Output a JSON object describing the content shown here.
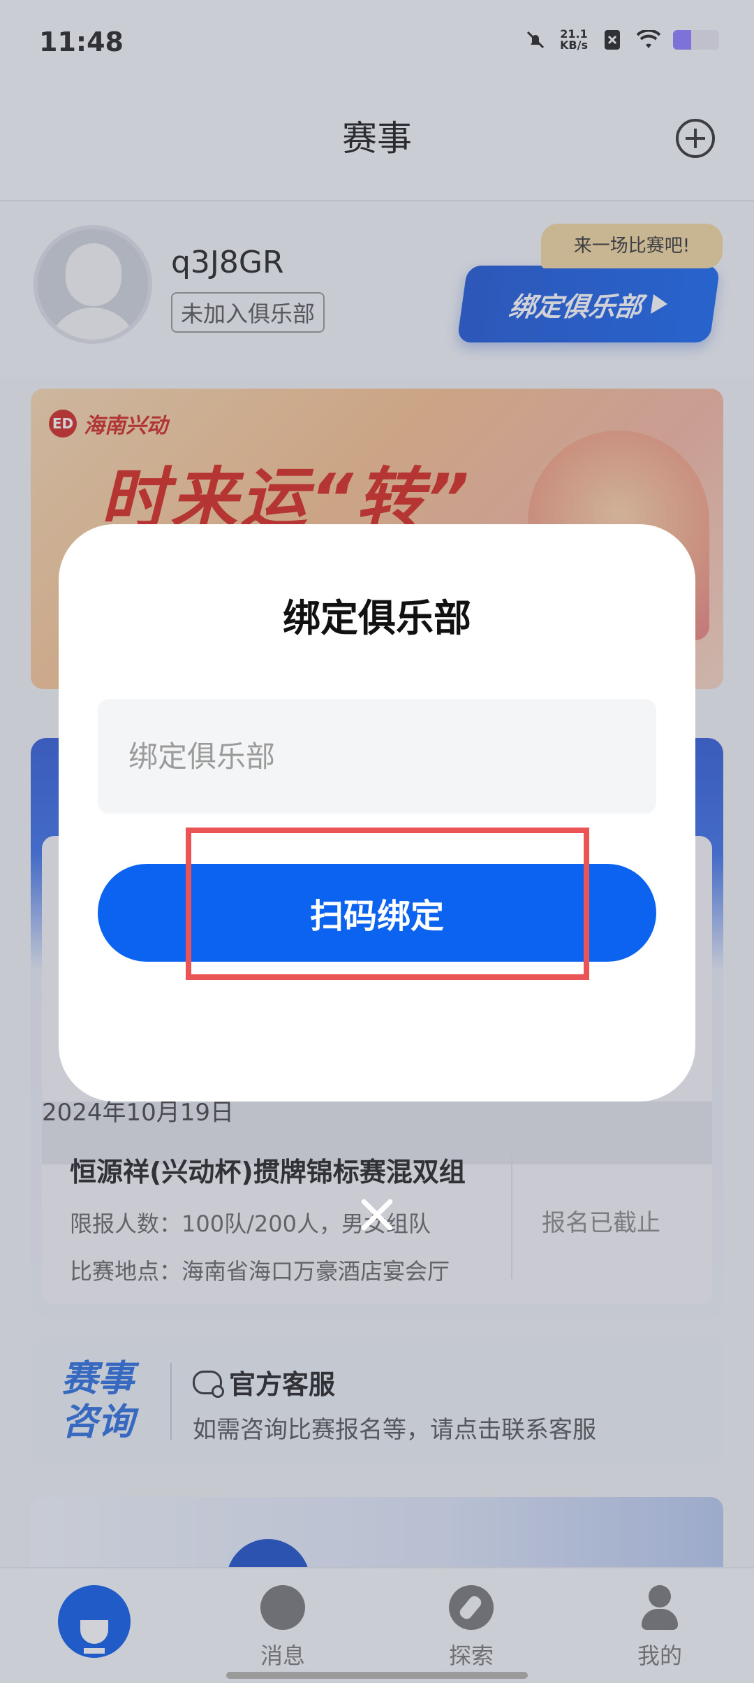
{
  "status_bar": {
    "time": "11:48",
    "net_speed_value": "21.1",
    "net_speed_unit": "KB/s",
    "battery_level": 0.4
  },
  "header": {
    "title": "赛事"
  },
  "profile": {
    "username": "q3J8GR",
    "club_status": "未加入俱乐部",
    "bubble_text": "来一场比赛吧!",
    "bind_button_label": "绑定俱乐部"
  },
  "banner": {
    "brand_logo": "ED",
    "brand_name": "海南兴动",
    "headline": "时来运“转”"
  },
  "event": {
    "date": "2024年10月19日",
    "title": "恒源祥(兴动杯)掼牌锦标赛混双组",
    "limit": "限报人数：100队/200人，男女组队",
    "venue": "比赛地点：海南省海口万豪酒店宴会厅",
    "status": "报名已截止"
  },
  "consult": {
    "logo_line1": "赛事",
    "logo_line2": "咨询",
    "title": "官方客服",
    "desc": "如需咨询比赛报名等，请点击联系客服"
  },
  "tabs": [
    {
      "label": ""
    },
    {
      "label": "消息"
    },
    {
      "label": "探索"
    },
    {
      "label": "我的"
    }
  ],
  "dialog": {
    "title": "绑定俱乐部",
    "input_placeholder": "绑定俱乐部",
    "input_value": "",
    "scan_button_label": "扫码绑定"
  },
  "colors": {
    "primary_blue": "#0b63f0",
    "highlight_red": "#ea5455"
  }
}
